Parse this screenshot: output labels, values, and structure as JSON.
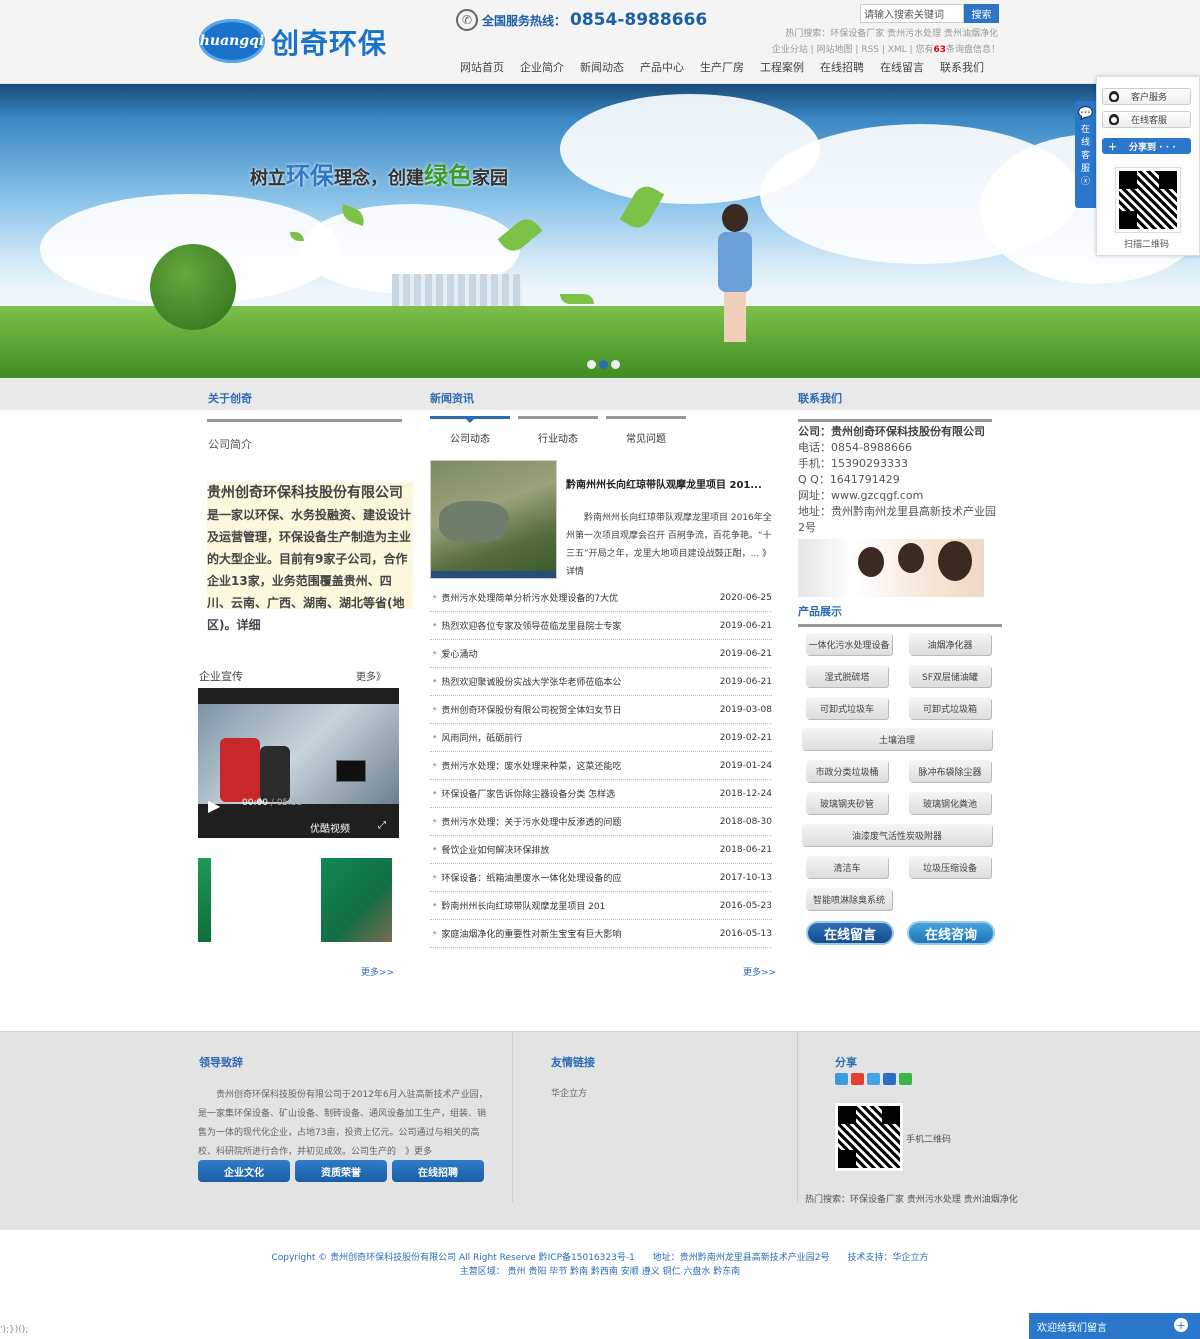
{
  "header": {
    "logo_mark": "huangqi",
    "logo_text": "创奇环保",
    "hotline_label": "全国服务热线：",
    "hotline_number": "0854-8988666",
    "search_placeholder": "请输入搜索关键词",
    "search_button": "搜索",
    "hot_search": "热门搜索：环保设备厂家  贵州污水处理  贵州油烟净化",
    "sub_links_prefix": "企业分站 | 网站地图 | RSS | XML | 您有",
    "sub_links_count": "63",
    "sub_links_suffix": "条询盘信息！"
  },
  "nav": [
    "网站首页",
    "企业简介",
    "新闻动态",
    "产品中心",
    "生产厂房",
    "工程案例",
    "在线招聘",
    "在线留言",
    "联系我们"
  ],
  "banner": {
    "slogan_a": "树立",
    "slogan_b": "环保",
    "slogan_c": "理念，创建",
    "slogan_d": "绿色",
    "slogan_e": "家园",
    "slides": 3,
    "active_slide": 2
  },
  "about": {
    "title": "关于创奇",
    "link": "公司简介",
    "text_big": "贵州创奇环保科技股份有限公司",
    "text_body": "是一家以环保、水务投融资、建设设计及运营管理，环保设备生产制造为主业的大型企业。目前有9家子公司，合作企业13家，业务范围覆盖贵州、四川、云南、广西、湖南、湖北等省(地区)。详细"
  },
  "promo": {
    "title": "企业宣传",
    "more": "更多》",
    "video_time": "00:00",
    "video_total": " / 05:55",
    "video_brand": "优酷视频",
    "more_bottom": "更多>>"
  },
  "news": {
    "title": "新闻资讯",
    "tabs": [
      "公司动态",
      "行业动态",
      "常见问题"
    ],
    "headline": "黔南州州长向红琼带队观摩龙里项目 201...",
    "summary": "黔南州州长向红琼带队观摩龙里项目 2016年全州第一次项目观摩会召开 百舸争流，百花争艳。“十三五”开局之年，龙里大地项目建设战鼓正酣，...",
    "detail": "》详情",
    "items": [
      {
        "title": "贵州污水处理简单分析污水处理设备的7大优",
        "date": "2020-06-25"
      },
      {
        "title": "热烈欢迎各位专家及领导莅临龙里县院士专家",
        "date": "2019-06-21"
      },
      {
        "title": "爱心涌动",
        "date": "2019-06-21"
      },
      {
        "title": "热烈欢迎聚诚股份实战大学张华老师莅临本公",
        "date": "2019-06-21"
      },
      {
        "title": "贵州创奇环保股份有限公司祝贺全体妇女节日",
        "date": "2019-03-08"
      },
      {
        "title": "风雨同州，砥砺前行",
        "date": "2019-02-21"
      },
      {
        "title": "贵州污水处理：废水处理来种菜，这菜还能吃",
        "date": "2019-01-24"
      },
      {
        "title": "环保设备厂家告诉你除尘器设备分类 怎样选",
        "date": "2018-12-24"
      },
      {
        "title": "贵州污水处理：关于污水处理中反渗透的问题",
        "date": "2018-08-30"
      },
      {
        "title": "餐饮企业如何解决环保排放",
        "date": "2018-06-21"
      },
      {
        "title": "环保设备：纸箱油墨废水一体化处理设备的应",
        "date": "2017-10-13"
      },
      {
        "title": "黔南州州长向红琼带队观摩龙里项目 201",
        "date": "2016-05-23"
      },
      {
        "title": "家庭油烟净化的重要性对新生宝宝有巨大影响",
        "date": "2016-05-13"
      }
    ],
    "more": "更多>>"
  },
  "contact": {
    "title": "联系我们",
    "company": "公司：贵州创奇环保科技股份有限公司",
    "phone": "电话：0854-8988666",
    "mobile": "手机：15390293333",
    "qq": "Q Q：1641791429",
    "web": "网址：www.gzcqgf.com",
    "address": "地址：贵州黔南州龙里县高新技术产业园2号"
  },
  "products": {
    "title": "产品展示",
    "items": [
      "一体化污水处理设备",
      "油烟净化器",
      "湿式脱硫塔",
      "SF双层储油罐",
      "可卸式垃圾车",
      "可卸式垃圾箱",
      "土壤治理",
      "市政分类垃圾桶",
      "脉冲布袋除尘器",
      "玻璃钢夹砂管",
      "玻璃钢化粪池",
      "油漆废气活性炭吸附器",
      "清洁车",
      "垃圾压缩设备",
      "智能喷淋除臭系统"
    ],
    "btn_message": "在线留言",
    "btn_consult": "在线咨询"
  },
  "footer": {
    "leader_title": "领导致辞",
    "leader_text": "贵州创奇环保科技股份有限公司于2012年6月入驻高新技术产业园，是一家集环保设备、矿山设备、制砖设备、通风设备加工生产，组装、销售为一体的现代化企业，占地73亩，投资上亿元。公司通过与相关的高校、科研院所进行合作，并初见成效。公司生产的　》更多",
    "buttons": [
      "企业文化",
      "资质荣誉",
      "在线招聘"
    ],
    "links_title": "友情链接",
    "links": [
      "华企立方"
    ],
    "share_title": "分享",
    "mobile_qr": "手机二维码",
    "hot_search": "热门搜索：环保设备厂家  贵州污水处理  贵州油烟净化",
    "copyright": "Copyright © 贵州创奇环保科技股份有限公司 All Right Reserve 黔ICP备15016323号-1　　地址：贵州黔南州龙里县高新技术产业园2号　　技术支持：华企立方",
    "areas": "主营区域： 贵州 贵阳 毕节 黔南 黔西南 安顺 遵义 铜仁 六盘水 黔东南"
  },
  "float": {
    "tab_text": "在线客服",
    "close": "ⓧ",
    "btn1": "客户服务",
    "btn2": "在线客服",
    "share": "分享到 · · ·",
    "qr_label": "扫描二维码"
  },
  "message_bar": "欢迎给我们留言",
  "corner_text": "');})();"
}
